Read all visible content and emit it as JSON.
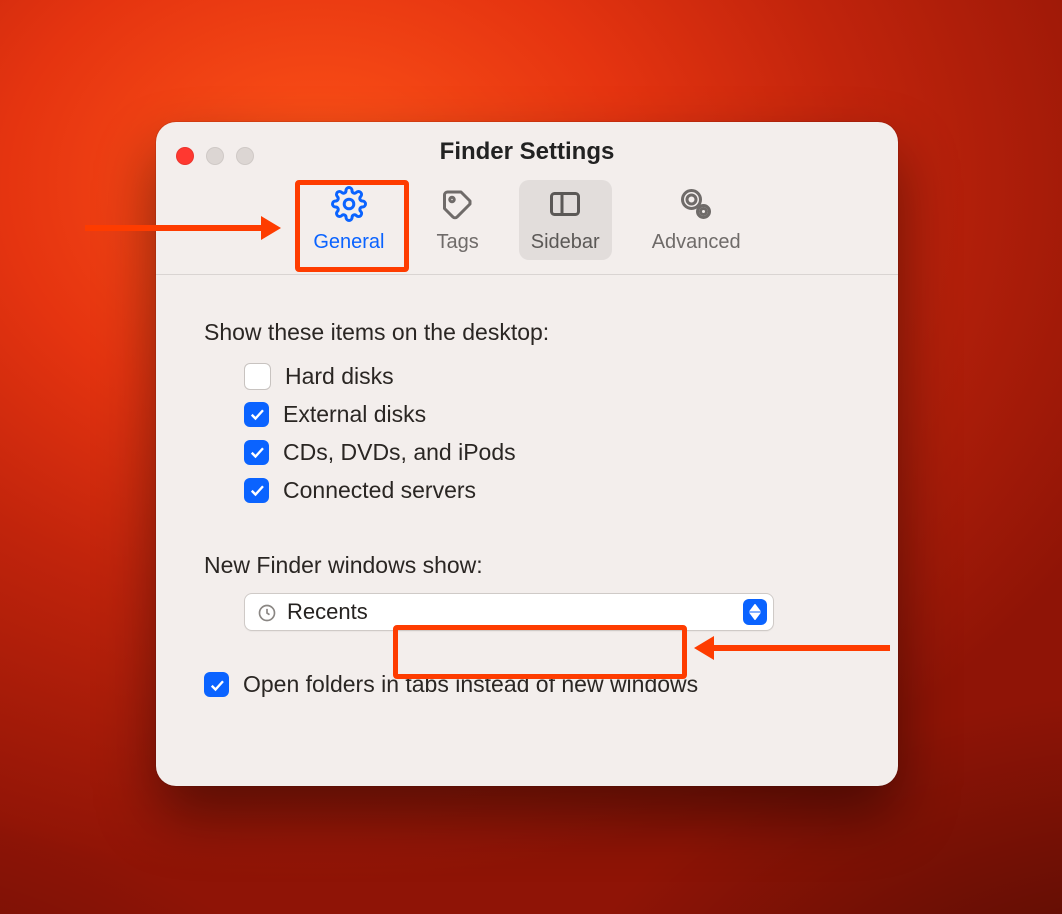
{
  "window": {
    "title": "Finder Settings"
  },
  "toolbar": {
    "general": "General",
    "tags": "Tags",
    "sidebar": "Sidebar",
    "advanced": "Advanced"
  },
  "desktop_items": {
    "section_label": "Show these items on the desktop:",
    "hard_disks": {
      "label": "Hard disks",
      "checked": false
    },
    "external_disks": {
      "label": "External disks",
      "checked": true
    },
    "cds": {
      "label": "CDs, DVDs, and iPods",
      "checked": true
    },
    "connected_servers": {
      "label": "Connected servers",
      "checked": true
    }
  },
  "new_windows": {
    "section_label": "New Finder windows show:",
    "selected": "Recents"
  },
  "open_in_tabs": {
    "label": "Open folders in tabs instead of new windows",
    "checked": true
  },
  "colors": {
    "accent": "#0a63ff",
    "annotation": "#fe3c00"
  }
}
